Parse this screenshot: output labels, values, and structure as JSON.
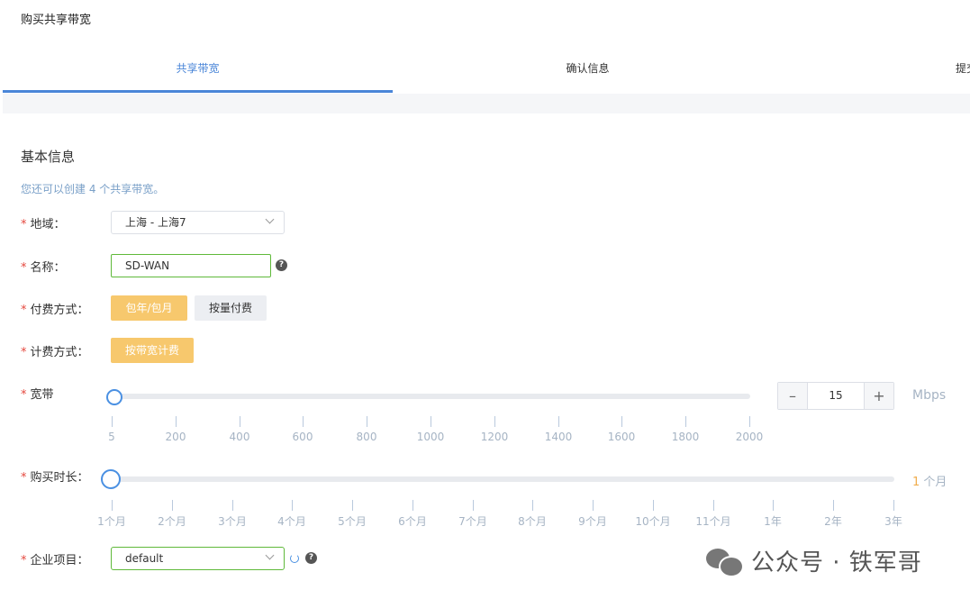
{
  "page": {
    "title": "购买共享带宽"
  },
  "tabs": [
    {
      "label": "共享带宽",
      "active": true
    },
    {
      "label": "确认信息",
      "active": false
    },
    {
      "label": "提交",
      "active": false
    }
  ],
  "section": {
    "title": "基本信息",
    "hint": "您还可以创建 4 个共享带宽。"
  },
  "form": {
    "required_mark": "*",
    "region": {
      "label": "地域：",
      "value": "上海 - 上海7"
    },
    "name": {
      "label": "名称：",
      "value": "SD-WAN",
      "help": "?"
    },
    "payment": {
      "label": "付费方式：",
      "options": [
        "包年/包月",
        "按量付费"
      ],
      "selected": "包年/包月"
    },
    "billing": {
      "label": "计费方式：",
      "options": [
        "按带宽计费"
      ],
      "selected": "按带宽计费"
    },
    "bandwidth": {
      "label": "宽带",
      "value": "15",
      "unit": "Mbps",
      "minus": "–",
      "plus": "+",
      "ticks": [
        "5",
        "200",
        "400",
        "600",
        "800",
        "1000",
        "1200",
        "1400",
        "1600",
        "1800",
        "2000"
      ]
    },
    "duration": {
      "label": "购买时长：",
      "value_num": "1",
      "value_unit": " 个月",
      "ticks": [
        "1个月",
        "2个月",
        "3个月",
        "4个月",
        "5个月",
        "6个月",
        "7个月",
        "8个月",
        "9个月",
        "10个月",
        "11个月",
        "1年",
        "2年",
        "3年"
      ]
    },
    "project": {
      "label": "企业项目：",
      "value": "default",
      "help": "?"
    }
  },
  "watermark": {
    "text": "公众号 · 铁军哥"
  },
  "colors": {
    "accent": "#4a86d8",
    "primary_button": "#f7c86d",
    "required": "#e5483e",
    "valid_border": "#5fb93a"
  }
}
